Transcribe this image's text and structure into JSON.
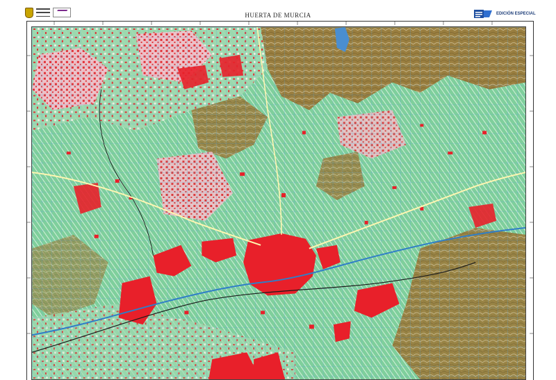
{
  "header": {
    "title": "HUERTA DE MURCIA",
    "edition": "EDICIÓN ESPECIAL"
  },
  "logos": {
    "left": "government-crest-logo",
    "right": "cnig-logo"
  },
  "colors": {
    "urban_red": "#e8202a",
    "urban_pink": "#f4a8b8",
    "farmland_green": "#7fcf9c",
    "irrigation_blue": "#5aa6d8",
    "relief_brown": "#8c6a2f",
    "paper": "#f6f1e6",
    "reservoir": "#4a8ed0"
  },
  "features": {
    "reservoir": "reservoir-water-body",
    "rail_line": "railway-line",
    "river": "river-segura"
  }
}
